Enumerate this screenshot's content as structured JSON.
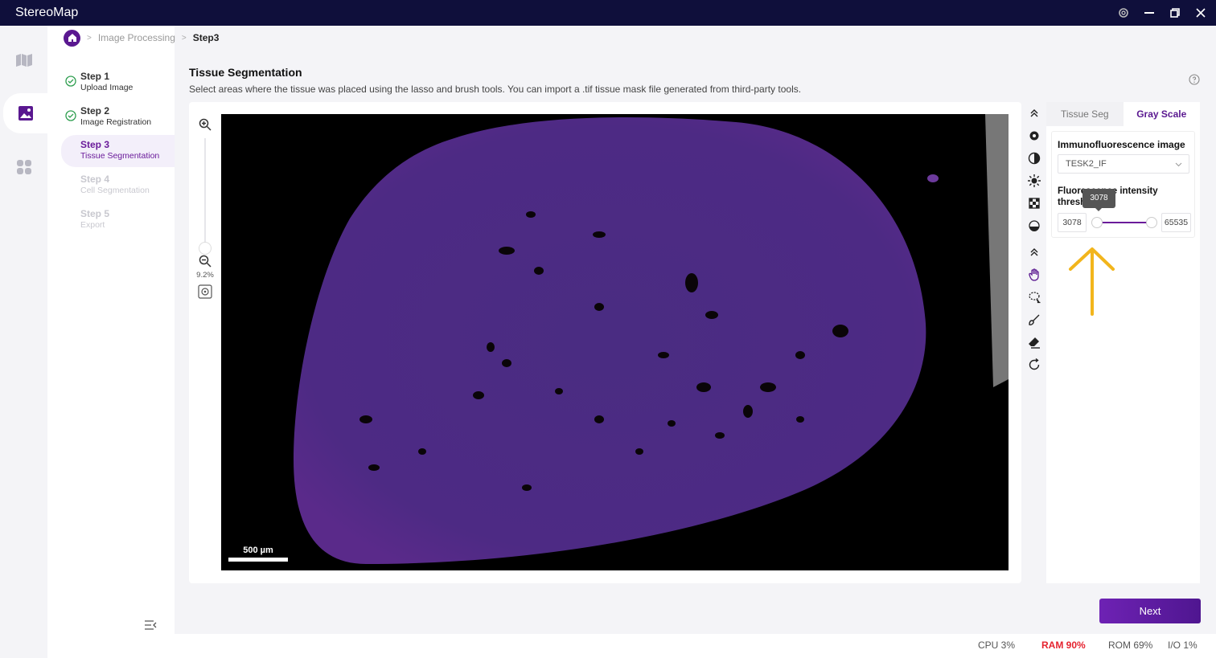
{
  "app": {
    "title": "StereoMap"
  },
  "breadcrumb": {
    "items": [
      "Image Processing",
      "Step3"
    ]
  },
  "steps": [
    {
      "title": "Step 1",
      "subtitle": "Upload Image",
      "state": "done"
    },
    {
      "title": "Step 2",
      "subtitle": "Image Registration",
      "state": "done"
    },
    {
      "title": "Step 3",
      "subtitle": "Tissue Segmentation",
      "state": "active"
    },
    {
      "title": "Step 4",
      "subtitle": "Cell Segmentation",
      "state": "pending"
    },
    {
      "title": "Step 5",
      "subtitle": "Export",
      "state": "pending"
    }
  ],
  "page": {
    "title": "Tissue Segmentation",
    "description": "Select areas where the tissue was placed using the lasso and brush tools. You can import a .tif tissue mask file generated from third-party tools."
  },
  "viewer": {
    "zoom_level": "9.2%",
    "scalebar_label": "500 µm",
    "icons": [
      "zoom-in-icon",
      "zoom-out-icon",
      "locate-icon"
    ]
  },
  "tools": [
    "collapse-up-icon",
    "settings-icon",
    "contrast-icon",
    "brightness-icon",
    "checker-icon",
    "drop-icon",
    "collapse-up-icon",
    "hand-icon",
    "lasso-icon",
    "brush-icon",
    "eraser-icon",
    "reset-icon"
  ],
  "panel": {
    "tabs": [
      {
        "label": "Tissue Seg",
        "active": false
      },
      {
        "label": "Gray Scale",
        "active": true
      }
    ],
    "image_label": "Immunofluorescence image",
    "image_value": "TESK2_IF",
    "threshold_label": "Fluorescence intensity threshold",
    "threshold_min": "3078",
    "threshold_max": "65535",
    "tooltip": "3078"
  },
  "actions": {
    "next_label": "Next"
  },
  "status": {
    "cpu": "CPU  3%",
    "ram": "RAM  90%",
    "rom": "ROM  69%",
    "io": "I/O  1%"
  },
  "colors": {
    "brand": "#5a1890",
    "titlebar": "#0f0f3b",
    "warn": "#e5232f",
    "tissue": "#4b2a80"
  }
}
